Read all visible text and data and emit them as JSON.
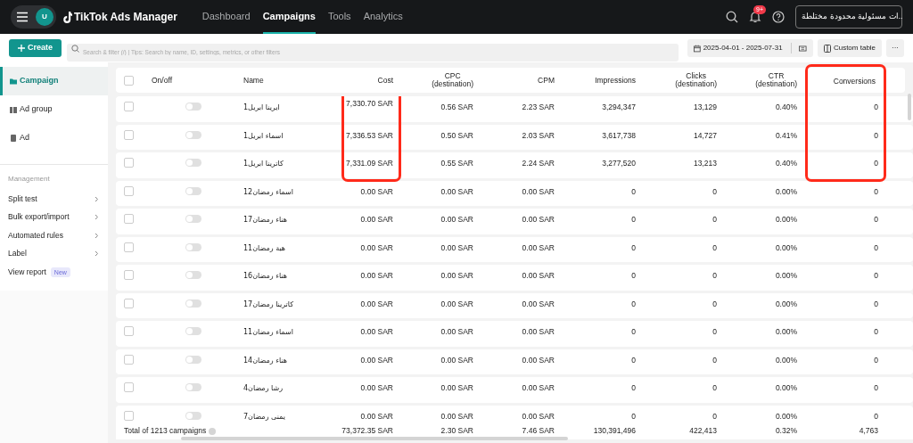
{
  "top_bar": {
    "avatar": "U",
    "logo": "TikTok Ads Manager",
    "tabs": [
      {
        "label": "Dashboard",
        "selected": false
      },
      {
        "label": "Campaigns",
        "selected": true
      },
      {
        "label": "Tools",
        "selected": false
      },
      {
        "label": "Analytics",
        "selected": false
      }
    ],
    "notification_badge": "9+",
    "account": "..ات مسئولية محدودة مختلطة"
  },
  "toolbar": {
    "create": "Create",
    "search": {
      "placeholder": "Search & filter (/) | Tips: Search by name, ID, settings, metrics, or other filters"
    },
    "date_range": "2025-04-01 - 2025-07-31",
    "custom_table": "Custom table",
    "more": "···"
  },
  "sidebar": {
    "levels": [
      {
        "label": "Campaign",
        "selected": true
      },
      {
        "label": "Ad group",
        "selected": false
      },
      {
        "label": "Ad",
        "selected": false
      }
    ],
    "section": "Management",
    "items": [
      {
        "label": "Split test",
        "arrow": true
      },
      {
        "label": "Bulk export/import",
        "arrow": true
      },
      {
        "label": "Automated rules",
        "arrow": true
      },
      {
        "label": "Label",
        "arrow": true
      },
      {
        "label": "View report",
        "badge": "New"
      }
    ]
  },
  "table": {
    "select_all_checked": false,
    "columns": [
      {
        "label": "On/off",
        "highlighted": false
      },
      {
        "label": "Name",
        "highlighted": false
      },
      {
        "label": "Cost",
        "highlighted": false
      },
      {
        "label": "CPC",
        "sublabel": "(destination)",
        "highlighted": false
      },
      {
        "label": "CPM",
        "highlighted": false
      },
      {
        "label": "Impressions",
        "highlighted": false
      },
      {
        "label": "Clicks",
        "sublabel": "(destination)",
        "highlighted": false
      },
      {
        "label": "CTR",
        "sublabel": "(destination)",
        "highlighted": false
      },
      {
        "label": "Conversions",
        "highlighted": true
      }
    ],
    "rows": [
      {
        "checked": false,
        "on": false,
        "name": "ايرينا ابريل1",
        "values": [
          {
            "text": "7,330.70 SAR",
            "highlighted": true
          },
          {
            "text": "0.56 SAR",
            "highlighted": false
          },
          {
            "text": "2.23 SAR",
            "highlighted": false
          },
          {
            "text": "3,294,347",
            "highlighted": false
          },
          {
            "text": "13,129",
            "highlighted": false
          },
          {
            "text": "0.40%",
            "highlighted": false
          },
          {
            "text": "0",
            "highlighted": true
          }
        ]
      },
      {
        "checked": false,
        "on": false,
        "name": "اسماء ابريل1",
        "values": [
          {
            "text": "7,336.53 SAR",
            "highlighted": true
          },
          {
            "text": "0.50 SAR",
            "highlighted": false
          },
          {
            "text": "2.03 SAR",
            "highlighted": false
          },
          {
            "text": "3,617,738",
            "highlighted": false
          },
          {
            "text": "14,727",
            "highlighted": false
          },
          {
            "text": "0.41%",
            "highlighted": false
          },
          {
            "text": "0",
            "highlighted": true
          }
        ]
      },
      {
        "checked": false,
        "on": false,
        "name": "كاترينا ابريل1",
        "values": [
          {
            "text": "7,331.09 SAR",
            "highlighted": true
          },
          {
            "text": "0.55 SAR",
            "highlighted": false
          },
          {
            "text": "2.24 SAR",
            "highlighted": false
          },
          {
            "text": "3,277,520",
            "highlighted": false
          },
          {
            "text": "13,213",
            "highlighted": false
          },
          {
            "text": "0.40%",
            "highlighted": false
          },
          {
            "text": "0",
            "highlighted": true
          }
        ]
      },
      {
        "checked": false,
        "on": false,
        "name": "اسماء رمضان12",
        "values": [
          {
            "text": "0.00 SAR",
            "highlighted": false
          },
          {
            "text": "0.00 SAR",
            "highlighted": false
          },
          {
            "text": "0.00 SAR",
            "highlighted": false
          },
          {
            "text": "0",
            "highlighted": false
          },
          {
            "text": "0",
            "highlighted": false
          },
          {
            "text": "0.00%",
            "highlighted": false
          },
          {
            "text": "0",
            "highlighted": false
          }
        ]
      },
      {
        "checked": false,
        "on": false,
        "name": "هناء رمضان17",
        "values": [
          {
            "text": "0.00 SAR",
            "highlighted": false
          },
          {
            "text": "0.00 SAR",
            "highlighted": false
          },
          {
            "text": "0.00 SAR",
            "highlighted": false
          },
          {
            "text": "0",
            "highlighted": false
          },
          {
            "text": "0",
            "highlighted": false
          },
          {
            "text": "0.00%",
            "highlighted": false
          },
          {
            "text": "0",
            "highlighted": false
          }
        ]
      },
      {
        "checked": false,
        "on": false,
        "name": "هبة رمضان11",
        "values": [
          {
            "text": "0.00 SAR",
            "highlighted": false
          },
          {
            "text": "0.00 SAR",
            "highlighted": false
          },
          {
            "text": "0.00 SAR",
            "highlighted": false
          },
          {
            "text": "0",
            "highlighted": false
          },
          {
            "text": "0",
            "highlighted": false
          },
          {
            "text": "0.00%",
            "highlighted": false
          },
          {
            "text": "0",
            "highlighted": false
          }
        ]
      },
      {
        "checked": false,
        "on": false,
        "name": "هناء رمضان16",
        "values": [
          {
            "text": "0.00 SAR",
            "highlighted": false
          },
          {
            "text": "0.00 SAR",
            "highlighted": false
          },
          {
            "text": "0.00 SAR",
            "highlighted": false
          },
          {
            "text": "0",
            "highlighted": false
          },
          {
            "text": "0",
            "highlighted": false
          },
          {
            "text": "0.00%",
            "highlighted": false
          },
          {
            "text": "0",
            "highlighted": false
          }
        ]
      },
      {
        "checked": false,
        "on": false,
        "name": "كاترينا رمضان17",
        "values": [
          {
            "text": "0.00 SAR",
            "highlighted": false
          },
          {
            "text": "0.00 SAR",
            "highlighted": false
          },
          {
            "text": "0.00 SAR",
            "highlighted": false
          },
          {
            "text": "0",
            "highlighted": false
          },
          {
            "text": "0",
            "highlighted": false
          },
          {
            "text": "0.00%",
            "highlighted": false
          },
          {
            "text": "0",
            "highlighted": false
          }
        ]
      },
      {
        "checked": false,
        "on": false,
        "name": "اسماء رمضان11",
        "values": [
          {
            "text": "0.00 SAR",
            "highlighted": false
          },
          {
            "text": "0.00 SAR",
            "highlighted": false
          },
          {
            "text": "0.00 SAR",
            "highlighted": false
          },
          {
            "text": "0",
            "highlighted": false
          },
          {
            "text": "0",
            "highlighted": false
          },
          {
            "text": "0.00%",
            "highlighted": false
          },
          {
            "text": "0",
            "highlighted": false
          }
        ]
      },
      {
        "checked": false,
        "on": false,
        "name": "هناء رمضان14",
        "values": [
          {
            "text": "0.00 SAR",
            "highlighted": false
          },
          {
            "text": "0.00 SAR",
            "highlighted": false
          },
          {
            "text": "0.00 SAR",
            "highlighted": false
          },
          {
            "text": "0",
            "highlighted": false
          },
          {
            "text": "0",
            "highlighted": false
          },
          {
            "text": "0.00%",
            "highlighted": false
          },
          {
            "text": "0",
            "highlighted": false
          }
        ]
      },
      {
        "checked": false,
        "on": false,
        "name": "رشا رمضان4",
        "values": [
          {
            "text": "0.00 SAR",
            "highlighted": false
          },
          {
            "text": "0.00 SAR",
            "highlighted": false
          },
          {
            "text": "0.00 SAR",
            "highlighted": false
          },
          {
            "text": "0",
            "highlighted": false
          },
          {
            "text": "0",
            "highlighted": false
          },
          {
            "text": "0.00%",
            "highlighted": false
          },
          {
            "text": "0",
            "highlighted": false
          }
        ]
      },
      {
        "checked": false,
        "on": false,
        "name": "يمنى رمضان7",
        "values": [
          {
            "text": "0.00 SAR",
            "highlighted": false
          },
          {
            "text": "0.00 SAR",
            "highlighted": false
          },
          {
            "text": "0.00 SAR",
            "highlighted": false
          },
          {
            "text": "0",
            "highlighted": false
          },
          {
            "text": "0",
            "highlighted": false
          },
          {
            "text": "0.00%",
            "highlighted": false
          },
          {
            "text": "0",
            "highlighted": false
          }
        ]
      }
    ],
    "total": {
      "label": "Total of 1213 campaigns",
      "values": [
        "73,372.35 SAR",
        "2.30 SAR",
        "7.46 SAR",
        "130,391,496",
        "422,413",
        "0.32%",
        "4,763"
      ]
    }
  }
}
